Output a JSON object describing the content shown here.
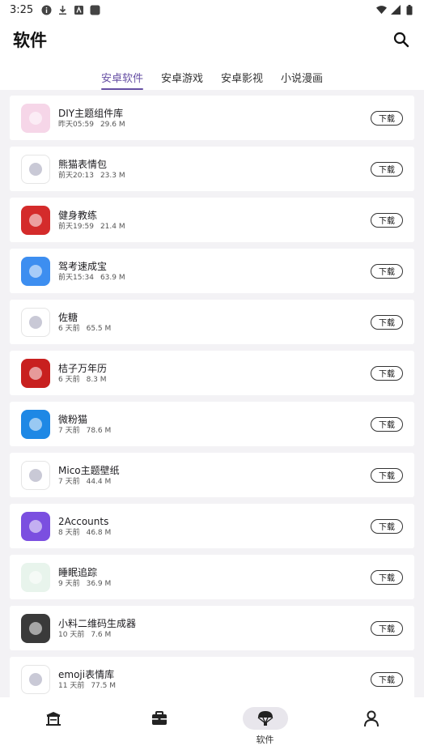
{
  "status_bar": {
    "time": "3:25"
  },
  "app_bar": {
    "title": "软件"
  },
  "tabs": [
    {
      "label": "安卓软件",
      "active": true
    },
    {
      "label": "安卓游戏",
      "active": false
    },
    {
      "label": "安卓影视",
      "active": false
    },
    {
      "label": "小说漫画",
      "active": false
    }
  ],
  "download_label": "下载",
  "apps": [
    {
      "name": "DIY主题组件库",
      "time": "昨天05:59",
      "size": "29.6 M",
      "icon": "diy-theme-icon",
      "color": "#f6d6e8"
    },
    {
      "name": "熊猫表情包",
      "time": "前天20:13",
      "size": "23.3 M",
      "icon": "panda-meme-icon",
      "color": "#ffffff"
    },
    {
      "name": "健身教练",
      "time": "前天19:59",
      "size": "21.4 M",
      "icon": "fitness-icon",
      "color": "#d42b2b"
    },
    {
      "name": "驾考速成宝",
      "time": "前天15:34",
      "size": "63.9 M",
      "icon": "driving-exam-icon",
      "color": "#3d8ef0"
    },
    {
      "name": "佐糖",
      "time": "6 天前",
      "size": "65.5 M",
      "icon": "zuotang-icon",
      "color": "#ffffff"
    },
    {
      "name": "桔子万年历",
      "time": "6 天前",
      "size": "8.3 M",
      "icon": "calendar-icon",
      "color": "#c8201f"
    },
    {
      "name": "微粉猫",
      "time": "7 天前",
      "size": "78.6 M",
      "icon": "weifenmao-icon",
      "color": "#1e88e5"
    },
    {
      "name": "Mico主题壁纸",
      "time": "7 天前",
      "size": "44.4 M",
      "icon": "mico-wallpaper-icon",
      "color": "#ffffff"
    },
    {
      "name": "2Accounts",
      "time": "8 天前",
      "size": "46.8 M",
      "icon": "two-accounts-icon",
      "color": "#7b4fe0"
    },
    {
      "name": "睡眠追踪",
      "time": "9 天前",
      "size": "36.9 M",
      "icon": "sleep-tracker-icon",
      "color": "#e8f4ec"
    },
    {
      "name": "小料二维码生成器",
      "time": "10 天前",
      "size": "7.6 M",
      "icon": "qr-generator-icon",
      "color": "#3a3a3a"
    },
    {
      "name": "emoji表情库",
      "time": "11 天前",
      "size": "77.5 M",
      "icon": "emoji-icon",
      "color": "#ffffff"
    }
  ],
  "bottom_nav": [
    {
      "label": "",
      "icon": "pavilion-icon",
      "active": false
    },
    {
      "label": "",
      "icon": "toolbox-icon",
      "active": false
    },
    {
      "label": "软件",
      "icon": "parachute-icon",
      "active": true
    },
    {
      "label": "",
      "icon": "profile-icon",
      "active": false
    }
  ]
}
